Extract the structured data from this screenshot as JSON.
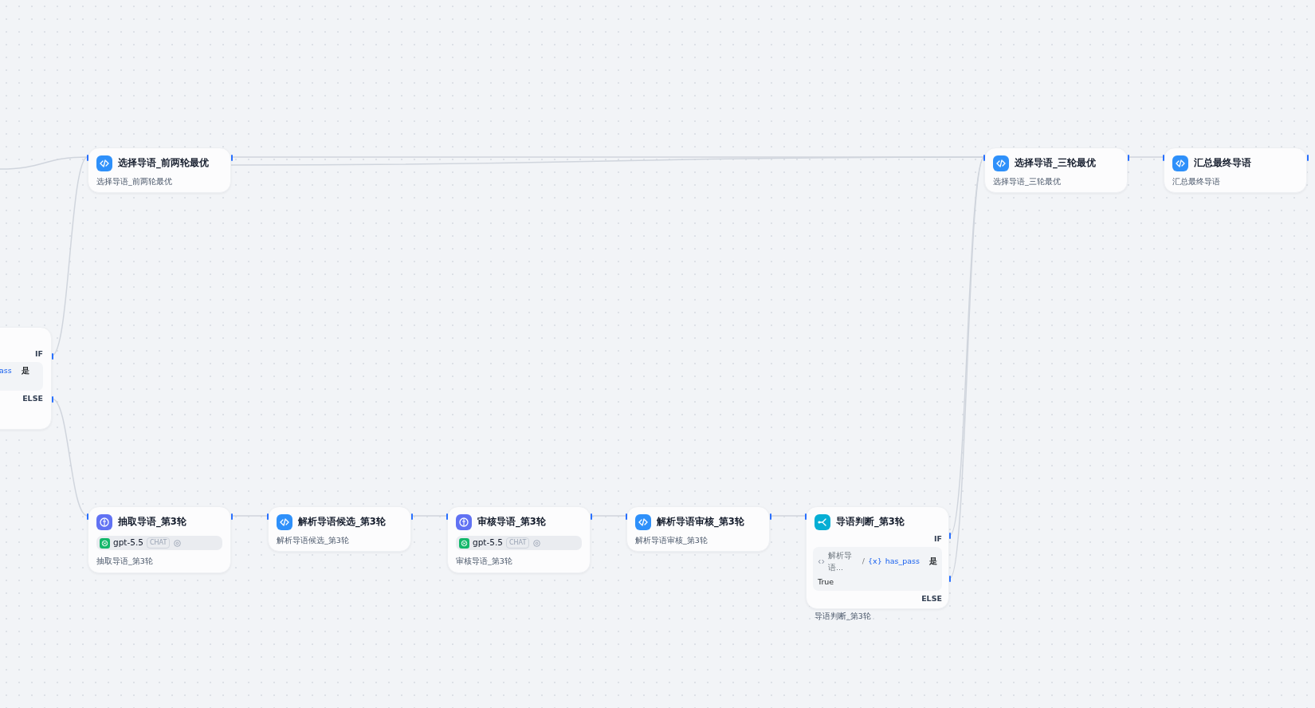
{
  "nodes": [
    {
      "kind": "if_else_partial",
      "if_label": "IF",
      "else_label": "ELSE",
      "conditions": [
        {
          "variable": "ass",
          "operator": "是"
        }
      ]
    },
    {
      "kind": "code",
      "title": "选择导语_前两轮最优",
      "description": "选择导语_前两轮最优"
    },
    {
      "kind": "code",
      "title": "选择导语_三轮最优",
      "description": "选择导语_三轮最优"
    },
    {
      "kind": "code",
      "title": "汇总最终导语",
      "description": "汇总最终导语"
    },
    {
      "kind": "llm",
      "title": "抽取导语_第3轮",
      "model": "gpt-5.5",
      "mode": "CHAT",
      "description": "抽取导语_第3轮"
    },
    {
      "kind": "code",
      "title": "解析导语候选_第3轮",
      "description": "解析导语候选_第3轮"
    },
    {
      "kind": "llm",
      "title": "审核导语_第3轮",
      "model": "gpt-5.5",
      "mode": "CHAT",
      "description": "审核导语_第3轮"
    },
    {
      "kind": "code",
      "title": "解析导语审核_第3轮",
      "description": "解析导语审核_第3轮"
    },
    {
      "kind": "if_else",
      "title": "导语判断_第3轮",
      "if_label": "IF",
      "else_label": "ELSE",
      "conditions": [
        {
          "source": "解析导语...",
          "separator": "/",
          "variable_mark": "{x}",
          "variable": "has_pass",
          "operator": "是",
          "value": "True"
        }
      ],
      "description": "导语判断_第3轮"
    }
  ]
}
